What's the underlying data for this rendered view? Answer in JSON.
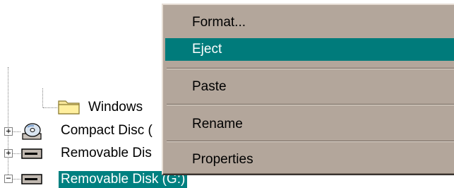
{
  "tree": {
    "items": [
      {
        "label": "Windows",
        "icon": "folder-icon",
        "expander": ""
      },
      {
        "label": "Compact Disc (",
        "icon": "cd-drive-icon",
        "expander": "+"
      },
      {
        "label": "Removable Dis",
        "icon": "removable-drive-icon",
        "expander": "+"
      },
      {
        "label": "Removable Disk (G:)",
        "icon": "removable-drive-icon",
        "expander": "−",
        "selected": true
      }
    ]
  },
  "context_menu": {
    "items": [
      {
        "label": "Format...",
        "highlighted": false
      },
      {
        "label": "Eject",
        "highlighted": true
      },
      {
        "label": "Paste",
        "highlighted": false
      },
      {
        "label": "Rename",
        "highlighted": false
      },
      {
        "label": "Properties",
        "highlighted": false
      }
    ]
  },
  "colors": {
    "selection": "#008080",
    "menu_background": "#b3a69b"
  }
}
